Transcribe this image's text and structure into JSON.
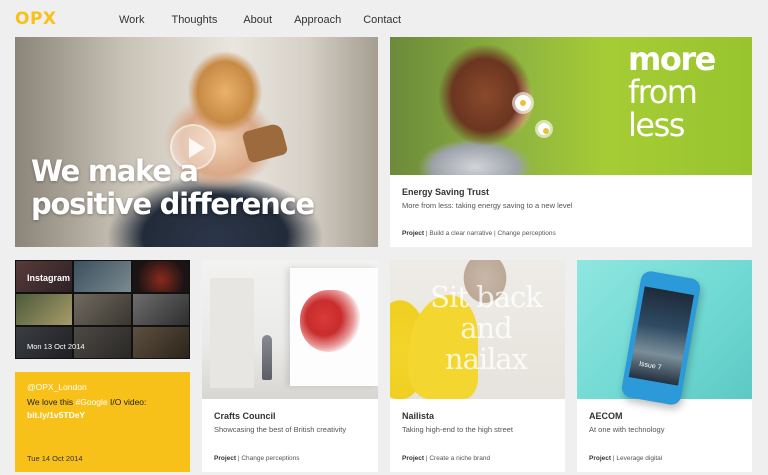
{
  "brand": {
    "logo": "OPX",
    "accent": "#f7c11a"
  },
  "nav": {
    "items": [
      "Work",
      "Thoughts",
      "About",
      "Approach",
      "Contact"
    ]
  },
  "hero": {
    "line1": "We make a",
    "line2": "positive difference"
  },
  "energy": {
    "headline": [
      "more",
      "from",
      "less"
    ],
    "title": "Energy Saving Trust",
    "desc": "More from less: taking energy saving to a new level",
    "meta_type": "Project",
    "meta_tags": " | Build a clear narrative | Change perceptions"
  },
  "instagram": {
    "label": "Instagram",
    "date": "Mon 13 Oct 2014"
  },
  "tweet": {
    "handle": "@OPX_London",
    "text_before": "We love this ",
    "hashtag": "#Google",
    "text_after": " I/O video: ",
    "link": "bit.ly/1v5TDeY",
    "date": "Tue 14 Oct 2014"
  },
  "crafts": {
    "title": "Crafts Council",
    "desc": "Showcasing the best of British creativity",
    "meta_type": "Project",
    "meta_tags": " | Change perceptions"
  },
  "nailista": {
    "image_text": [
      "Sit back",
      "and",
      "nailax"
    ],
    "title": "Nailista",
    "desc": "Taking high-end to the high street",
    "meta_type": "Project",
    "meta_tags": " | Create a niche brand"
  },
  "aecom": {
    "phone_text": "Issue 7",
    "title": "AECOM",
    "desc": "At one with technology",
    "meta_type": "Project",
    "meta_tags": " | Leverage digital"
  }
}
